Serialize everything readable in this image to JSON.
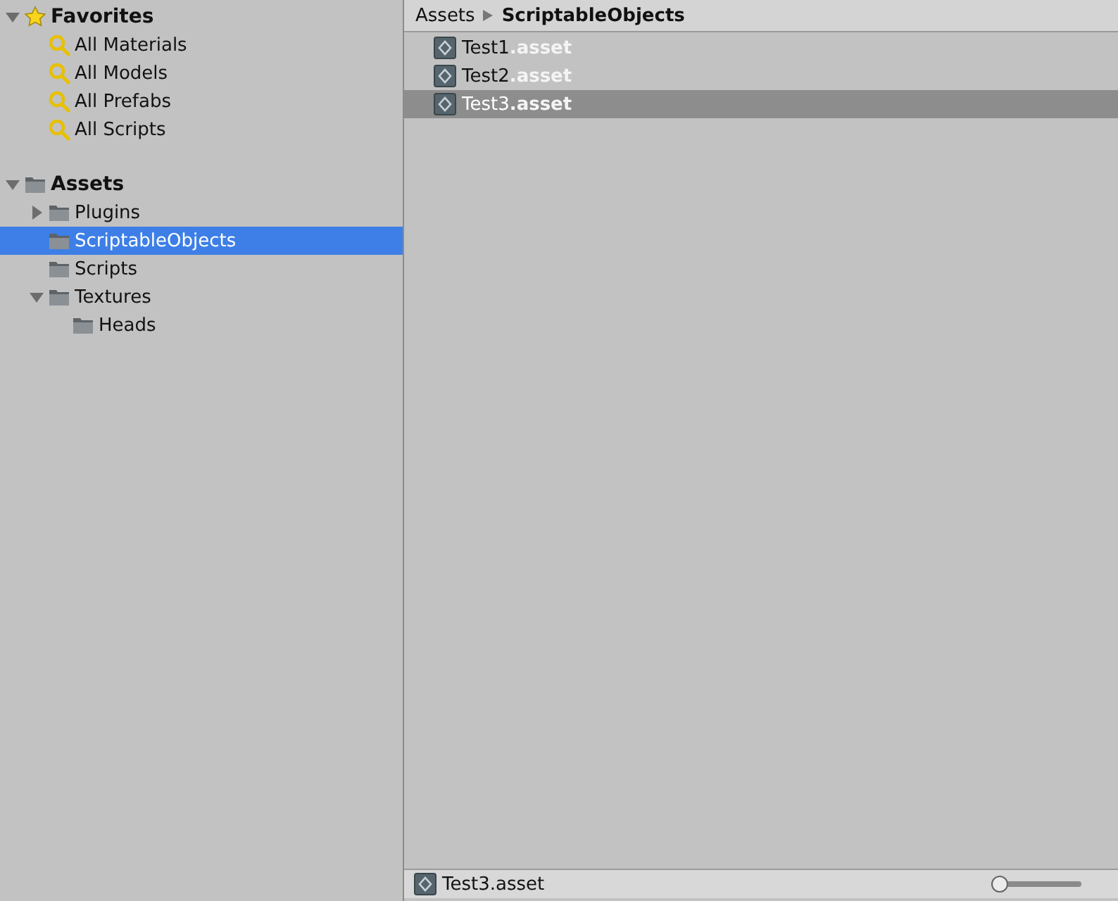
{
  "sidebar": {
    "groups": [
      {
        "label": "Favorites",
        "kind": "star",
        "expanded": true,
        "selected": false,
        "children": [
          {
            "label": "All Materials",
            "kind": "search",
            "selected": false
          },
          {
            "label": "All Models",
            "kind": "search",
            "selected": false
          },
          {
            "label": "All Prefabs",
            "kind": "search",
            "selected": false
          },
          {
            "label": "All Scripts",
            "kind": "search",
            "selected": false
          }
        ]
      },
      {
        "label": "Assets",
        "kind": "folder",
        "expanded": true,
        "selected": false,
        "children": [
          {
            "label": "Plugins",
            "kind": "folder",
            "expanded": false,
            "selected": false
          },
          {
            "label": "ScriptableObjects",
            "kind": "folder",
            "selected": true
          },
          {
            "label": "Scripts",
            "kind": "folder",
            "selected": false
          },
          {
            "label": "Textures",
            "kind": "folder",
            "expanded": true,
            "selected": false,
            "children": [
              {
                "label": "Heads",
                "kind": "folder",
                "selected": false
              }
            ]
          }
        ]
      }
    ]
  },
  "breadcrumb": [
    "Assets",
    "ScriptableObjects"
  ],
  "files": [
    {
      "name": "Test1",
      "extension": ".asset",
      "selected": false
    },
    {
      "name": "Test2",
      "extension": ".asset",
      "selected": false
    },
    {
      "name": "Test3",
      "extension": ".asset",
      "selected": true
    }
  ],
  "status_bar": {
    "file": "Test3.asset",
    "zoom": {
      "level": 0
    }
  }
}
